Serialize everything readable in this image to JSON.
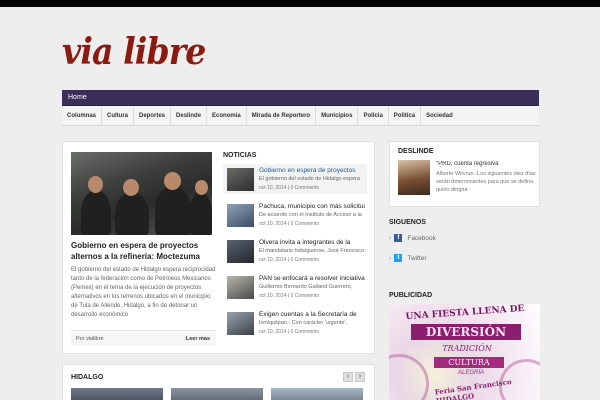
{
  "site": {
    "logo": "via libre"
  },
  "mainnav": {
    "home": "Home"
  },
  "categories": [
    "Columnas",
    "Cultura",
    "Deportes",
    "Deslinde",
    "Economia",
    "Mirada de Reportero",
    "Municipios",
    "Policia",
    "Politica",
    "Sociedad"
  ],
  "featured": {
    "title": "Gobierno en espera de proyectos alternos a la refinería: Moctezuma",
    "excerpt": "El gobierno del estado de Hidalgo espera reciprocidad tanto de la federación como de Petróleos Mexicanos (Pemex) en el tema de la ejecución de proyectos alternativos en los terrenos ubicados en el municipio de Tula de Allende, Hidalgo, a fin de detonar un desarrollo económico",
    "author": "Por vialibre",
    "more": "Leer mas"
  },
  "noticias": {
    "heading": "NOTICIAS",
    "items": [
      {
        "title": "Gobierno en espera de proyectos",
        "excerpt": "El gobierno del estado de Hidalgo espera",
        "meta": "oct 10, 2014 | 0 Comments"
      },
      {
        "title": "Pachuca, municipio con más solicitudes",
        "excerpt": "De acuerdo con el Instituto de Acceso a la",
        "meta": "oct 10, 2014 | 0 Comments"
      },
      {
        "title": "Olvera invita a integrantes de la",
        "excerpt": "El mandatario hidalguense, José Francisco",
        "meta": "oct 10, 2014 | 0 Comments"
      },
      {
        "title": "PAN se enfocará a resolver iniciativas",
        "excerpt": "Guillermo Bernardo Galland Guerrero,",
        "meta": "oct 10, 2014 | 0 Comments"
      },
      {
        "title": "Exigen cuentas a la Secretaría de",
        "excerpt": "Ixmiquilpan.- Con carácter 'urgente',",
        "meta": "oct 10, 2014 | 0 Comments"
      }
    ]
  },
  "deslinde": {
    "heading": "DESLINDE",
    "title": "\"PRD, cuenta regresiva",
    "excerpt": "Alberto Witvrun.-Los siguientes diez días serán determinantes para que se defina quién dirigirá"
  },
  "siguenos": {
    "heading": "SIGUENOS",
    "facebook": "Facebook",
    "twitter": "Twitter",
    "facebook_color": "#3b5998",
    "twitter_color": "#1da1f2"
  },
  "publicidad": {
    "heading": "PUBLICIDAD",
    "line1": "UNA FIESTA LLENA DE",
    "line2": "DIVERSIÓN",
    "line3": "TRADICIÓN",
    "line4": "CULTURA",
    "line5": "ALEGRÍA",
    "feria": "Feria San Francisco HIDALGO"
  },
  "hidalgo": {
    "heading": "HIDALGO",
    "prev": "‹",
    "next": "›"
  },
  "colors": {
    "accent": "#3a2e5a",
    "logo": "#8b1a10",
    "link": "#1a5aa0"
  }
}
